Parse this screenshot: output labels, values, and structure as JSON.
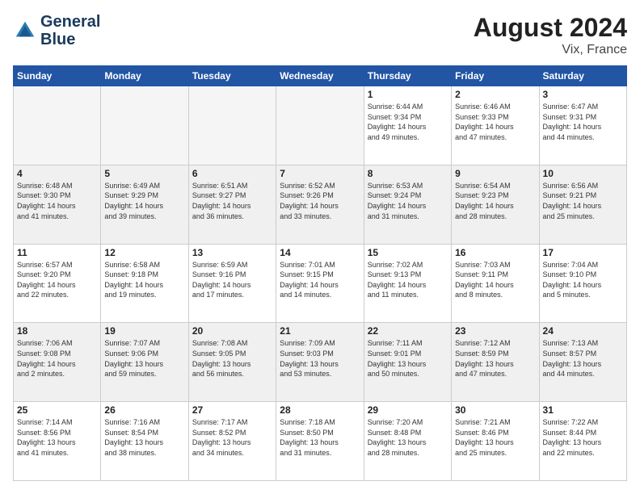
{
  "header": {
    "logo_line1": "General",
    "logo_line2": "Blue",
    "month": "August 2024",
    "location": "Vix, France"
  },
  "weekdays": [
    "Sunday",
    "Monday",
    "Tuesday",
    "Wednesday",
    "Thursday",
    "Friday",
    "Saturday"
  ],
  "weeks": [
    [
      {
        "day": "",
        "info": "",
        "empty": true
      },
      {
        "day": "",
        "info": "",
        "empty": true
      },
      {
        "day": "",
        "info": "",
        "empty": true
      },
      {
        "day": "",
        "info": "",
        "empty": true
      },
      {
        "day": "1",
        "info": "Sunrise: 6:44 AM\nSunset: 9:34 PM\nDaylight: 14 hours\nand 49 minutes."
      },
      {
        "day": "2",
        "info": "Sunrise: 6:46 AM\nSunset: 9:33 PM\nDaylight: 14 hours\nand 47 minutes."
      },
      {
        "day": "3",
        "info": "Sunrise: 6:47 AM\nSunset: 9:31 PM\nDaylight: 14 hours\nand 44 minutes."
      }
    ],
    [
      {
        "day": "4",
        "info": "Sunrise: 6:48 AM\nSunset: 9:30 PM\nDaylight: 14 hours\nand 41 minutes."
      },
      {
        "day": "5",
        "info": "Sunrise: 6:49 AM\nSunset: 9:29 PM\nDaylight: 14 hours\nand 39 minutes."
      },
      {
        "day": "6",
        "info": "Sunrise: 6:51 AM\nSunset: 9:27 PM\nDaylight: 14 hours\nand 36 minutes."
      },
      {
        "day": "7",
        "info": "Sunrise: 6:52 AM\nSunset: 9:26 PM\nDaylight: 14 hours\nand 33 minutes."
      },
      {
        "day": "8",
        "info": "Sunrise: 6:53 AM\nSunset: 9:24 PM\nDaylight: 14 hours\nand 31 minutes."
      },
      {
        "day": "9",
        "info": "Sunrise: 6:54 AM\nSunset: 9:23 PM\nDaylight: 14 hours\nand 28 minutes."
      },
      {
        "day": "10",
        "info": "Sunrise: 6:56 AM\nSunset: 9:21 PM\nDaylight: 14 hours\nand 25 minutes."
      }
    ],
    [
      {
        "day": "11",
        "info": "Sunrise: 6:57 AM\nSunset: 9:20 PM\nDaylight: 14 hours\nand 22 minutes."
      },
      {
        "day": "12",
        "info": "Sunrise: 6:58 AM\nSunset: 9:18 PM\nDaylight: 14 hours\nand 19 minutes."
      },
      {
        "day": "13",
        "info": "Sunrise: 6:59 AM\nSunset: 9:16 PM\nDaylight: 14 hours\nand 17 minutes."
      },
      {
        "day": "14",
        "info": "Sunrise: 7:01 AM\nSunset: 9:15 PM\nDaylight: 14 hours\nand 14 minutes."
      },
      {
        "day": "15",
        "info": "Sunrise: 7:02 AM\nSunset: 9:13 PM\nDaylight: 14 hours\nand 11 minutes."
      },
      {
        "day": "16",
        "info": "Sunrise: 7:03 AM\nSunset: 9:11 PM\nDaylight: 14 hours\nand 8 minutes."
      },
      {
        "day": "17",
        "info": "Sunrise: 7:04 AM\nSunset: 9:10 PM\nDaylight: 14 hours\nand 5 minutes."
      }
    ],
    [
      {
        "day": "18",
        "info": "Sunrise: 7:06 AM\nSunset: 9:08 PM\nDaylight: 14 hours\nand 2 minutes."
      },
      {
        "day": "19",
        "info": "Sunrise: 7:07 AM\nSunset: 9:06 PM\nDaylight: 13 hours\nand 59 minutes."
      },
      {
        "day": "20",
        "info": "Sunrise: 7:08 AM\nSunset: 9:05 PM\nDaylight: 13 hours\nand 56 minutes."
      },
      {
        "day": "21",
        "info": "Sunrise: 7:09 AM\nSunset: 9:03 PM\nDaylight: 13 hours\nand 53 minutes."
      },
      {
        "day": "22",
        "info": "Sunrise: 7:11 AM\nSunset: 9:01 PM\nDaylight: 13 hours\nand 50 minutes."
      },
      {
        "day": "23",
        "info": "Sunrise: 7:12 AM\nSunset: 8:59 PM\nDaylight: 13 hours\nand 47 minutes."
      },
      {
        "day": "24",
        "info": "Sunrise: 7:13 AM\nSunset: 8:57 PM\nDaylight: 13 hours\nand 44 minutes."
      }
    ],
    [
      {
        "day": "25",
        "info": "Sunrise: 7:14 AM\nSunset: 8:56 PM\nDaylight: 13 hours\nand 41 minutes."
      },
      {
        "day": "26",
        "info": "Sunrise: 7:16 AM\nSunset: 8:54 PM\nDaylight: 13 hours\nand 38 minutes."
      },
      {
        "day": "27",
        "info": "Sunrise: 7:17 AM\nSunset: 8:52 PM\nDaylight: 13 hours\nand 34 minutes."
      },
      {
        "day": "28",
        "info": "Sunrise: 7:18 AM\nSunset: 8:50 PM\nDaylight: 13 hours\nand 31 minutes."
      },
      {
        "day": "29",
        "info": "Sunrise: 7:20 AM\nSunset: 8:48 PM\nDaylight: 13 hours\nand 28 minutes."
      },
      {
        "day": "30",
        "info": "Sunrise: 7:21 AM\nSunset: 8:46 PM\nDaylight: 13 hours\nand 25 minutes."
      },
      {
        "day": "31",
        "info": "Sunrise: 7:22 AM\nSunset: 8:44 PM\nDaylight: 13 hours\nand 22 minutes."
      }
    ]
  ]
}
